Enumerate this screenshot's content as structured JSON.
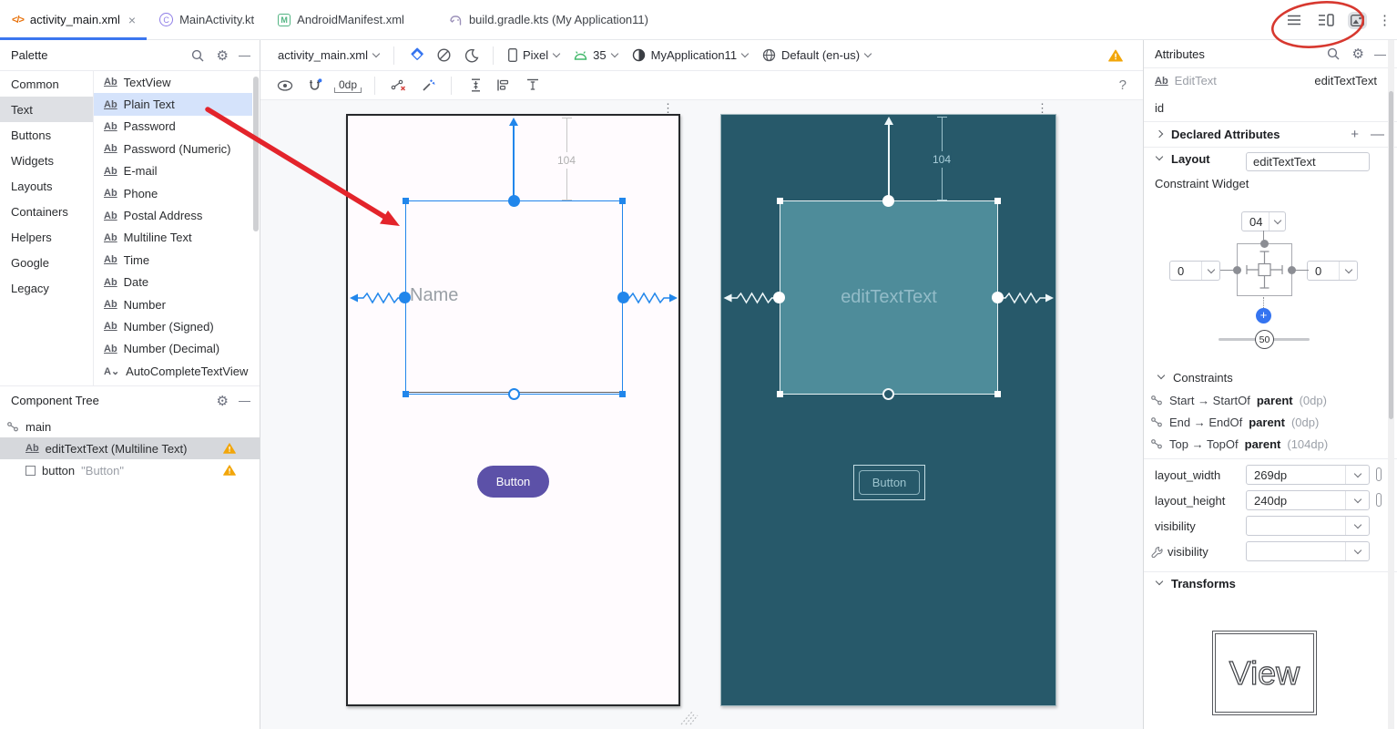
{
  "glyphs": {
    "close": "×",
    "more": "⋮",
    "help": "?",
    "gear": "⚙",
    "minimize": "—",
    "plus": "+",
    "ab_icon": "Ab",
    "xml_icon": "</>",
    "kotlin_letter": "C",
    "manifest_letter": "M"
  },
  "tabbar": {
    "tabs": [
      {
        "label": "activity_main.xml"
      },
      {
        "label": "MainActivity.kt"
      },
      {
        "label": "AndroidManifest.xml"
      },
      {
        "label": "build.gradle.kts (My Application11)"
      }
    ]
  },
  "toolbar": {
    "file_selector": "activity_main.xml",
    "device": "Pixel",
    "api_level": "35",
    "theme": "MyApplication11",
    "locale": "Default (en-us)",
    "default_margin": "0dp"
  },
  "palette": {
    "title": "Palette",
    "categories": [
      "Common",
      "Text",
      "Buttons",
      "Widgets",
      "Layouts",
      "Containers",
      "Helpers",
      "Google",
      "Legacy"
    ],
    "items": [
      "TextView",
      "Plain Text",
      "Password",
      "Password (Numeric)",
      "E-mail",
      "Phone",
      "Postal Address",
      "Multiline Text",
      "Time",
      "Date",
      "Number",
      "Number (Signed)",
      "Number (Decimal)",
      "AutoCompleteTextView"
    ]
  },
  "component_tree": {
    "title": "Component Tree",
    "root": "main",
    "edittext_label": "editTextText (Multiline Text)",
    "button_label": "button",
    "button_value": "\"Button\""
  },
  "canvas": {
    "design_view": {
      "placeholder": "Name",
      "button_label": "Button",
      "top_margin": "104"
    },
    "blueprint_view": {
      "component_label": "editTextText",
      "button_label": "Button",
      "top_margin": "104"
    }
  },
  "attributes": {
    "title": "Attributes",
    "component_type": "EditText",
    "component_id": "editTextText",
    "id_label": "id",
    "id_value": "editTextText",
    "declared_attributes_label": "Declared Attributes",
    "layout_label": "Layout",
    "constraint_widget_label": "Constraint Widget",
    "widget": {
      "top_margin": "04",
      "left_margin": "0",
      "right_margin": "0",
      "bias": "50"
    },
    "constraints_label": "Constraints",
    "constraints": [
      {
        "text": "Start → StartOf",
        "target": "parent",
        "value": "(0dp)"
      },
      {
        "text": "End → EndOf",
        "target": "parent",
        "value": "(0dp)"
      },
      {
        "text": "Top → TopOf",
        "target": "parent",
        "value": "(104dp)"
      }
    ],
    "fields": [
      {
        "label": "layout_width",
        "value": "269dp"
      },
      {
        "label": "layout_height",
        "value": "240dp"
      },
      {
        "label": "visibility",
        "value": ""
      },
      {
        "label": "visibility",
        "value": ""
      }
    ],
    "transforms_label": "Transforms",
    "view_preview_label": "View"
  }
}
